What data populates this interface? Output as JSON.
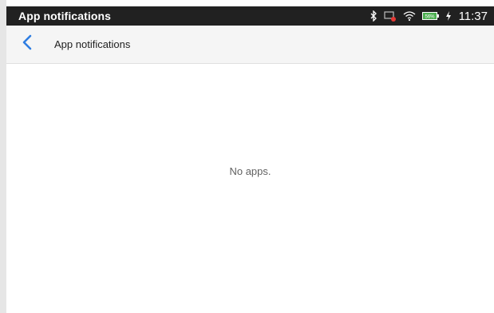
{
  "status_bar": {
    "title": "App notifications",
    "battery_percent": "56%",
    "time": "11:37",
    "icons": [
      "bluetooth-icon",
      "cast-icon",
      "wifi-icon",
      "battery-icon",
      "charging-icon"
    ]
  },
  "toolbar": {
    "back_icon": "chevron-left-icon",
    "title": "App notifications"
  },
  "content": {
    "empty_message": "No apps."
  },
  "colors": {
    "status_bar_bg": "#212121",
    "toolbar_bg": "#f5f5f5",
    "accent": "#2f7de1",
    "battery_green": "#4caf50"
  }
}
